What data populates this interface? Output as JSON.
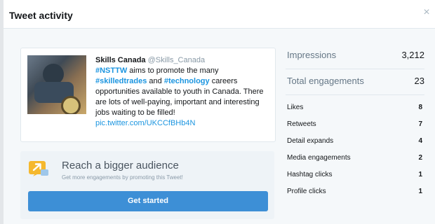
{
  "dialog": {
    "title": "Tweet activity",
    "close_icon": "×"
  },
  "tweet": {
    "author": "Skills Canada",
    "handle": "@Skills_Canada",
    "hashtag1": "#NSTTW",
    "text1": " aims to promote the many ",
    "hashtag2": "#skilledtrades",
    "text2": " and ",
    "hashtag3": "#technology",
    "text3": " careers opportunities available to youth in Canada. There are lots of well-paying, important and interesting jobs waiting to be filled! ",
    "link": "pic.twitter.com/UKCCfBHb4N"
  },
  "promo": {
    "title": "Reach a bigger audience",
    "subtitle": "Get more engagements by promoting this Tweet!",
    "button_label": "Get started",
    "accent_color": "#3d8fd6",
    "icon": "promote-arrow-icon"
  },
  "stats": {
    "primary": [
      {
        "label": "Impressions",
        "value": "3,212"
      },
      {
        "label": "Total engagements",
        "value": "23"
      }
    ],
    "details": [
      {
        "label": "Likes",
        "value": "8"
      },
      {
        "label": "Retweets",
        "value": "7"
      },
      {
        "label": "Detail expands",
        "value": "4"
      },
      {
        "label": "Media engagements",
        "value": "2"
      },
      {
        "label": "Hashtag clicks",
        "value": "1"
      },
      {
        "label": "Profile clicks",
        "value": "1"
      }
    ]
  }
}
